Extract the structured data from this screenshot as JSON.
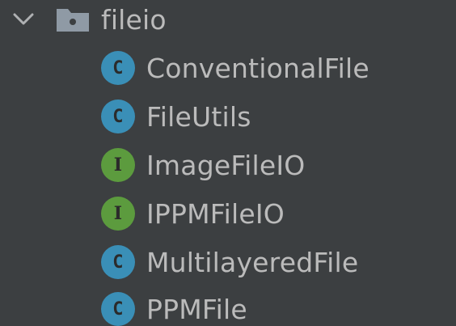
{
  "tree": {
    "folder": {
      "label": "fileio",
      "icon": "folder-icon",
      "expanded_icon": "chevron-down-icon"
    },
    "items": [
      {
        "label": "ConventionalFile",
        "kind": "class",
        "badge": "C",
        "color": "#3a8fb7"
      },
      {
        "label": "FileUtils",
        "kind": "class",
        "badge": "C",
        "color": "#3a8fb7"
      },
      {
        "label": "ImageFileIO",
        "kind": "interface",
        "badge": "I",
        "color": "#5c9b3e"
      },
      {
        "label": "IPPMFileIO",
        "kind": "interface",
        "badge": "I",
        "color": "#5c9b3e"
      },
      {
        "label": "MultilayeredFile",
        "kind": "class",
        "badge": "C",
        "color": "#3a8fb7"
      },
      {
        "label": "PPMFile",
        "kind": "class",
        "badge": "C",
        "color": "#3a8fb7"
      }
    ]
  }
}
